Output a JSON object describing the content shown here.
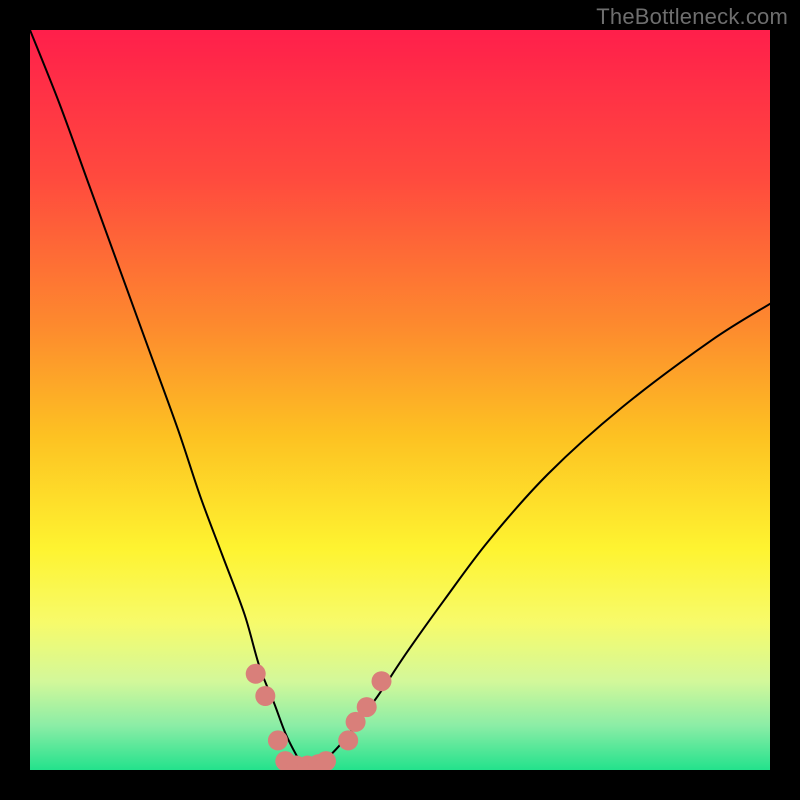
{
  "watermark": "TheBottleneck.com",
  "chart_data": {
    "type": "line",
    "title": "",
    "xlabel": "",
    "ylabel": "",
    "xlim": [
      0,
      100
    ],
    "ylim": [
      0,
      100
    ],
    "grid": false,
    "legend": false,
    "plot_background": {
      "type": "vertical-gradient",
      "stops": [
        {
          "offset": 0.0,
          "color": "#ff1f4b"
        },
        {
          "offset": 0.2,
          "color": "#ff4a3e"
        },
        {
          "offset": 0.4,
          "color": "#fd8a2e"
        },
        {
          "offset": 0.55,
          "color": "#fdc222"
        },
        {
          "offset": 0.7,
          "color": "#fef330"
        },
        {
          "offset": 0.8,
          "color": "#f7fb6a"
        },
        {
          "offset": 0.88,
          "color": "#d3f89a"
        },
        {
          "offset": 0.94,
          "color": "#8beda6"
        },
        {
          "offset": 1.0,
          "color": "#23e28c"
        }
      ]
    },
    "series": [
      {
        "name": "bottleneck-curve",
        "color": "#000000",
        "width": 2,
        "x": [
          0,
          4,
          8,
          12,
          16,
          20,
          23,
          26,
          29,
          31,
          33,
          34.5,
          36,
          37,
          38,
          40,
          42,
          44,
          47,
          51,
          56,
          62,
          70,
          80,
          92,
          100
        ],
        "y": [
          100,
          90,
          79,
          68,
          57,
          46,
          37,
          29,
          21,
          14,
          9,
          5,
          2,
          0.5,
          0.5,
          1.5,
          3.5,
          6,
          10,
          16,
          23,
          31,
          40,
          49,
          58,
          63
        ]
      }
    ],
    "markers": {
      "name": "highlight-dots",
      "color": "#d97f7a",
      "radius": 10,
      "points": [
        {
          "x": 30.5,
          "y": 13
        },
        {
          "x": 31.8,
          "y": 10
        },
        {
          "x": 33.5,
          "y": 4
        },
        {
          "x": 34.5,
          "y": 1.2
        },
        {
          "x": 36.0,
          "y": 0.6
        },
        {
          "x": 37.5,
          "y": 0.6
        },
        {
          "x": 39.0,
          "y": 0.8
        },
        {
          "x": 40.0,
          "y": 1.2
        },
        {
          "x": 43.0,
          "y": 4.0
        },
        {
          "x": 44.0,
          "y": 6.5
        },
        {
          "x": 45.5,
          "y": 8.5
        },
        {
          "x": 47.5,
          "y": 12.0
        }
      ]
    }
  }
}
